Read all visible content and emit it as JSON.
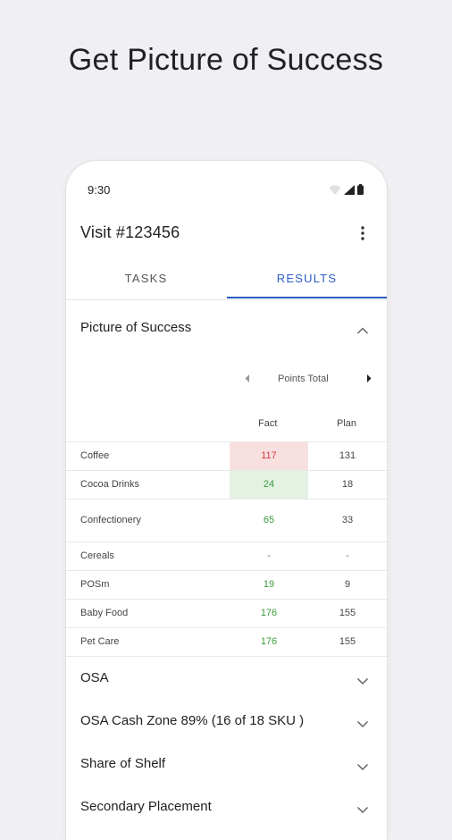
{
  "headline": "Get Picture of Success",
  "status": {
    "time": "9:30"
  },
  "app_bar": {
    "title": "Visit #123456"
  },
  "tabs": [
    {
      "label": "TASKS",
      "active": false
    },
    {
      "label": "RESULTS",
      "active": true
    }
  ],
  "picture_section": {
    "title": "Picture of Success",
    "expanded": true
  },
  "points_nav": {
    "label": "Points Total"
  },
  "table": {
    "columns": [
      "Fact",
      "Plan"
    ],
    "rows": [
      {
        "name": "Coffee",
        "fact": "117",
        "plan": "131",
        "status": "under"
      },
      {
        "name": "Cocoa Drinks",
        "fact": "24",
        "plan": "18",
        "status": "over-highlight"
      },
      {
        "name": "Confectionery",
        "fact": "65",
        "plan": "33",
        "status": "over"
      },
      {
        "name": "Cereals",
        "fact": "-",
        "plan": "-",
        "status": "none"
      },
      {
        "name": "POSm",
        "fact": "19",
        "plan": "9",
        "status": "over"
      },
      {
        "name": "Baby Food",
        "fact": "176",
        "plan": "155",
        "status": "over"
      },
      {
        "name": "Pet Care",
        "fact": "176",
        "plan": "155",
        "status": "over"
      }
    ]
  },
  "sections": [
    {
      "title": "OSA"
    },
    {
      "title": "OSA Cash Zone 89% (16 of 18 SKU )"
    },
    {
      "title": "Share of Shelf"
    },
    {
      "title": "Secondary Placement"
    }
  ],
  "colors": {
    "accent": "#2b5cc7",
    "positive": "#3a9a3a",
    "negative": "#d43a3a",
    "positive_bg": "#e3f2e3",
    "negative_bg": "#f8e0e0"
  },
  "icons": {
    "status": [
      "wifi-icon",
      "signal-icon",
      "battery-icon"
    ],
    "menu": "more-vert-icon",
    "expand": "chevron-up-icon",
    "collapse": "chevron-down-icon",
    "nav": [
      "arrow-left-icon",
      "arrow-right-icon"
    ]
  }
}
